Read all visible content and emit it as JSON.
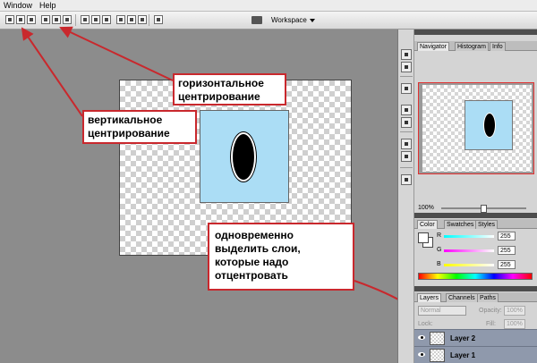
{
  "menubar": {
    "items": [
      "Window",
      "Help"
    ]
  },
  "toolbar": {
    "workspace_label": "Workspace",
    "icons": [
      "align-top-icon",
      "align-vertical-center-icon",
      "align-bottom-icon",
      "align-left-icon",
      "align-horizontal-center-icon",
      "align-right-icon",
      "distribute-top-icon",
      "distribute-vcenter-icon",
      "distribute-bottom-icon",
      "distribute-left-icon",
      "distribute-hcenter-icon",
      "distribute-right-icon",
      "auto-align-icon",
      "camera-icon"
    ]
  },
  "annotations": {
    "horizontal": "горизонтальное\nцентрирование",
    "vertical": "вертикальное\nцентрирование",
    "select_layers": "одновременно\nвыделить слои,\nкоторые надо\nотцентровать",
    "arrow_color": "#c9282d"
  },
  "canvas": {
    "layer_color": "#abddf5",
    "ellipse_color": "#000000"
  },
  "navigator": {
    "tabs": [
      "Navigator",
      "Histogram",
      "Info"
    ],
    "zoom": "100%"
  },
  "color": {
    "tabs": [
      "Color",
      "Swatches",
      "Styles"
    ],
    "channels": [
      {
        "label": "R",
        "value": "255"
      },
      {
        "label": "G",
        "value": "255"
      },
      {
        "label": "B",
        "value": "255"
      }
    ]
  },
  "layers": {
    "tabs": [
      "Layers",
      "Channels",
      "Paths"
    ],
    "blend_mode": "Normal",
    "opacity_label": "Opacity:",
    "opacity_value": "100%",
    "lock_label": "Lock:",
    "fill_label": "Fill:",
    "fill_value": "100%",
    "rows": [
      {
        "name": "Layer 2"
      },
      {
        "name": "Layer 1"
      }
    ]
  }
}
